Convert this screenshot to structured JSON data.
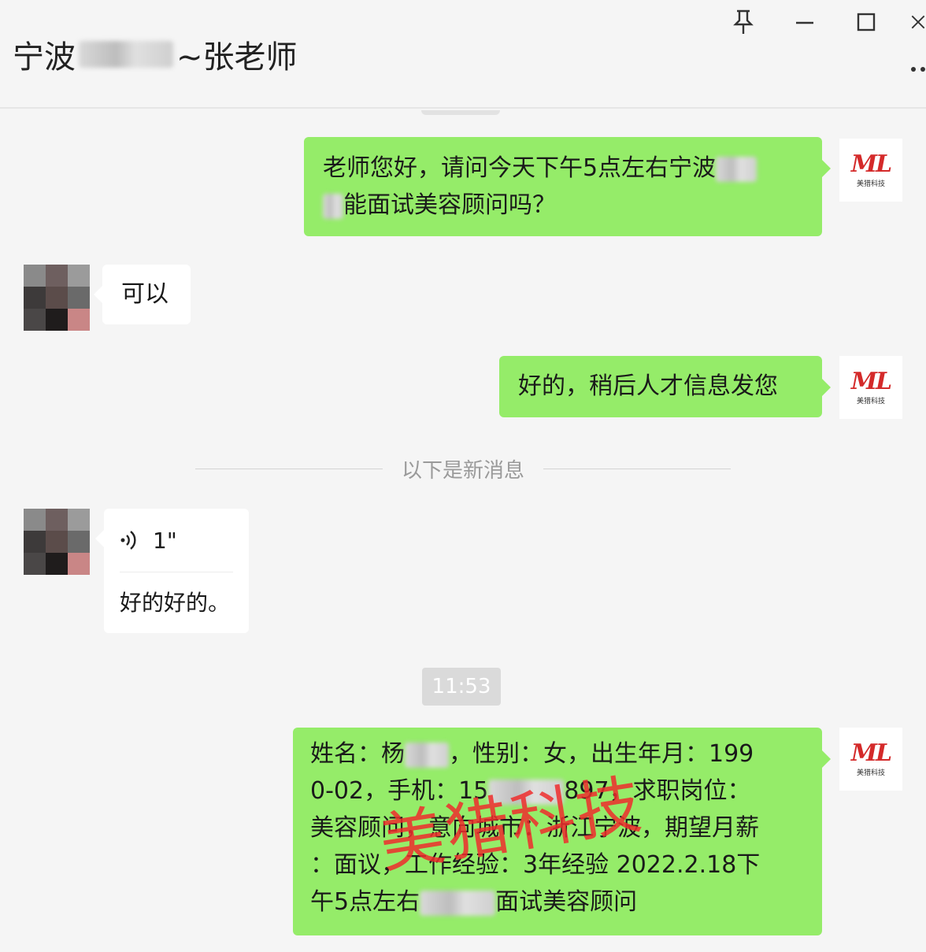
{
  "header": {
    "title_prefix": "宁波",
    "title_suffix": "~张老师"
  },
  "window_controls": {
    "pin_icon": "pin-icon",
    "minimize_icon": "minimize-icon",
    "maximize_icon": "maximize-icon",
    "close_icon": "close-icon",
    "more_icon": "more-icon"
  },
  "messages": {
    "m1": {
      "line1": "老师您好，请问今天下午5点左右宁波",
      "line2": "能面试美容顾问吗？"
    },
    "m2": {
      "text": "可以"
    },
    "m3": {
      "text": "好的，稍后人才信息发您"
    },
    "divider": "以下是新消息",
    "m4": {
      "duration": "1\"",
      "transcript": "好的好的。"
    },
    "timestamp": "11:53",
    "m5": {
      "l1a": "姓名：杨",
      "l1b": "，性别：女，出生年月：199",
      "l2a": "0-02，手机：15",
      "l2b": "897，求职岗位：",
      "l3a": "美容顾问，",
      "l3b": "意向城市：浙江宁波，期望月薪",
      "l4": "：面议，工作经验：3年经验 2022.2.18下",
      "l5a": "午5点左右",
      "l5b": "面试美容顾问"
    }
  },
  "logo": {
    "brand": "ML",
    "sub": "美猎科技"
  },
  "watermark": "美猎科技",
  "colors": {
    "sent_bubble": "#95ec69",
    "received_bubble": "#ffffff",
    "background": "#f5f5f5",
    "watermark": "#ee2d2d"
  }
}
